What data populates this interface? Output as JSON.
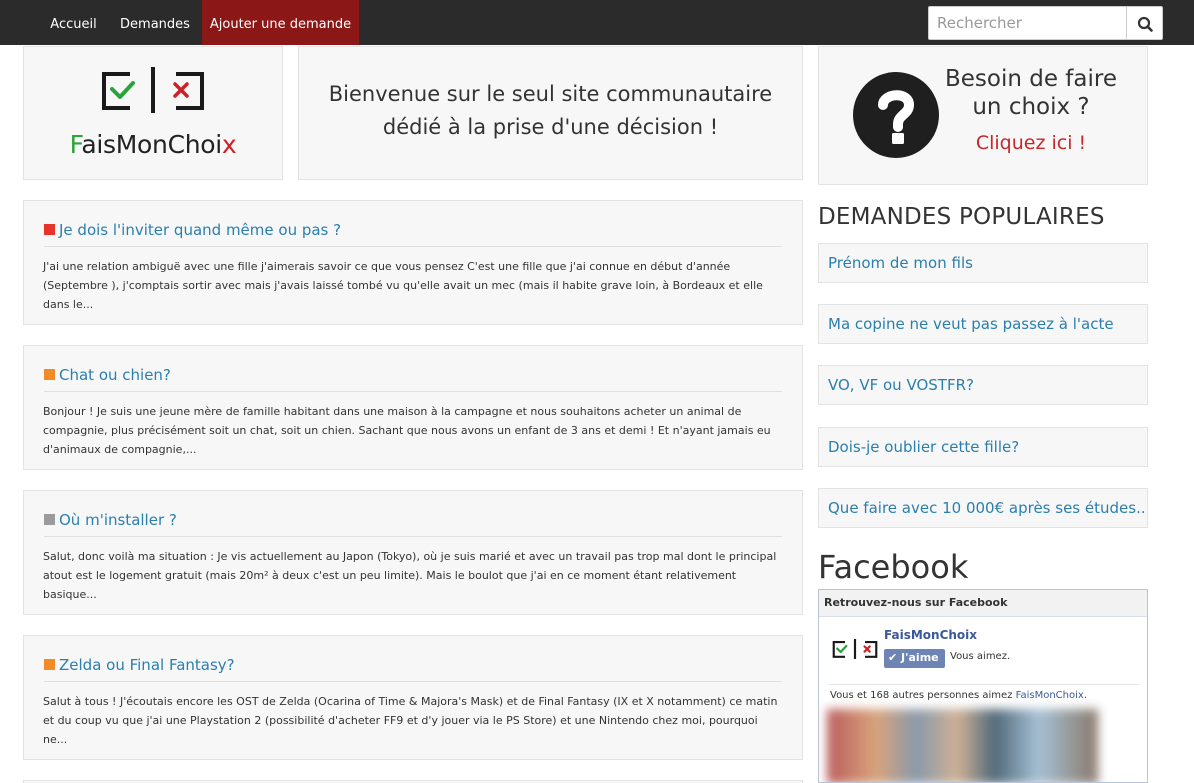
{
  "nav": {
    "items": [
      {
        "label": "Accueil"
      },
      {
        "label": "Demandes"
      },
      {
        "label": "Ajouter une demande"
      }
    ],
    "search_placeholder": "Rechercher"
  },
  "logo": {
    "f": "F",
    "middle": "aisMonChoi",
    "x": "x"
  },
  "welcome": {
    "text": "Bienvenue sur le seul site communautaire dédié à la prise d'une décision !"
  },
  "choice": {
    "title": "Besoin de faire un choix ?",
    "link": "Cliquez ici !"
  },
  "posts": [
    {
      "title": "Je dois l'inviter quand même ou pas ?",
      "color": "#e8322c",
      "excerpt": "J'ai une relation ambiguë avec une fille j'aimerais savoir ce que vous pensez C'est une fille que j'ai connue en début d'année (Septembre ), j'comptais sortir avec mais j'avais laissé tombé vu qu'elle avait un mec (mais il habite grave loin, à Bordeaux et elle dans le..."
    },
    {
      "title": "Chat ou chien?",
      "color": "#f28a25",
      "excerpt": "Bonjour ! Je suis une jeune mère de famille habitant dans une maison à la campagne et nous souhaitons acheter un animal de compagnie, plus précisément soit un chat, soit un chien. Sachant que nous avons un enfant de 3 ans et demi ! Et n'ayant jamais eu d'animaux de compagnie,..."
    },
    {
      "title": "Où m'installer ?",
      "color": "#9b9b9b",
      "excerpt": "Salut, donc voilà ma situation : Je vis actuellement au Japon (Tokyo), où je suis marié et avec un travail pas trop mal dont le principal atout est le logement gratuit (mais 20m² à deux c'est un peu limite). Mais le boulot que j'ai en ce moment étant relativement basique..."
    },
    {
      "title": "Zelda ou Final Fantasy?",
      "color": "#f28a25",
      "excerpt": "Salut à tous ! J'écoutais encore les OST de Zelda (Ocarina of Time & Majora's Mask) et de Final Fantasy (IX et X notamment) ce matin et du coup vu que j'ai une Playstation 2 (possibilité d'acheter FF9 et d'y jouer via le PS Store) et une Nintendo chez moi, pourquoi ne..."
    }
  ],
  "popular": {
    "title": "DEMANDES POPULAIRES",
    "items": [
      {
        "label": "Prénom de mon fils"
      },
      {
        "label": "Ma copine ne veut pas passez à l'acte"
      },
      {
        "label": "VO, VF ou VOSTFR?"
      },
      {
        "label": "Dois-je oublier cette fille?"
      },
      {
        "label": "Que faire avec 10 000€ après ses études..."
      }
    ]
  },
  "facebook": {
    "title": "Facebook",
    "header": "Retrouvez-nous sur Facebook",
    "page_name": "FaisMonChoix",
    "like_label": "J'aime",
    "you_like": "Vous aimez.",
    "count_text": "Vous et 168 autres personnes aimez ",
    "count_link": "FaisMonChoix",
    "count_end": "."
  }
}
